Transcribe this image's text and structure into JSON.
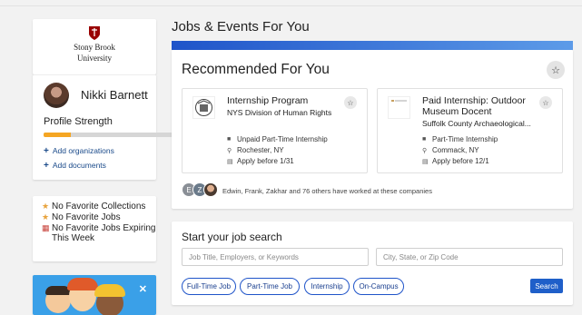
{
  "sidebar": {
    "logo": {
      "line1": "Stony Brook",
      "line2": "University"
    },
    "profile": {
      "name": "Nikki Barnett",
      "strength_label": "Profile Strength",
      "strength_value": 0.2,
      "add_organizations": "Add organizations",
      "add_documents": "Add documents"
    },
    "favorites": [
      {
        "icon": "star-icon",
        "text": "No Favorite Collections"
      },
      {
        "icon": "star-icon",
        "text": "No Favorite Jobs"
      },
      {
        "icon": "calendar-icon",
        "text": "No Favorite Jobs Expiring This Week"
      }
    ]
  },
  "main": {
    "heading": "Jobs & Events For You",
    "recommended": {
      "title": "Recommended For You",
      "jobs": [
        {
          "title": "Internship Program",
          "org": "NYS Division of Human Rights",
          "type": "Unpaid Part-Time Internship",
          "location": "Rochester, NY",
          "deadline": "Apply before 1/31"
        },
        {
          "title": "Paid Internship: Outdoor Museum Docent",
          "org": "Suffolk County Archaeological...",
          "type": "Part-Time Internship",
          "location": "Commack, NY",
          "deadline": "Apply before 12/1"
        }
      ],
      "avatar_initials": [
        "E",
        "Z"
      ],
      "worked_text": "Edwin, Frank, Zakhar and 76 others have worked at these companies"
    },
    "search": {
      "title": "Start your job search",
      "keyword_placeholder": "Job Title, Employers, or Keywords",
      "location_placeholder": "City, State, or Zip Code",
      "chips": [
        "Full-Time Job",
        "Part-Time Job",
        "Internship",
        "On-Campus"
      ],
      "button": "Search"
    }
  },
  "colors": {
    "accent": "#1f5fc9",
    "strength_bar": "#f5a623",
    "promo_bg": "#3aa0e8",
    "brand_red": "#990000"
  }
}
